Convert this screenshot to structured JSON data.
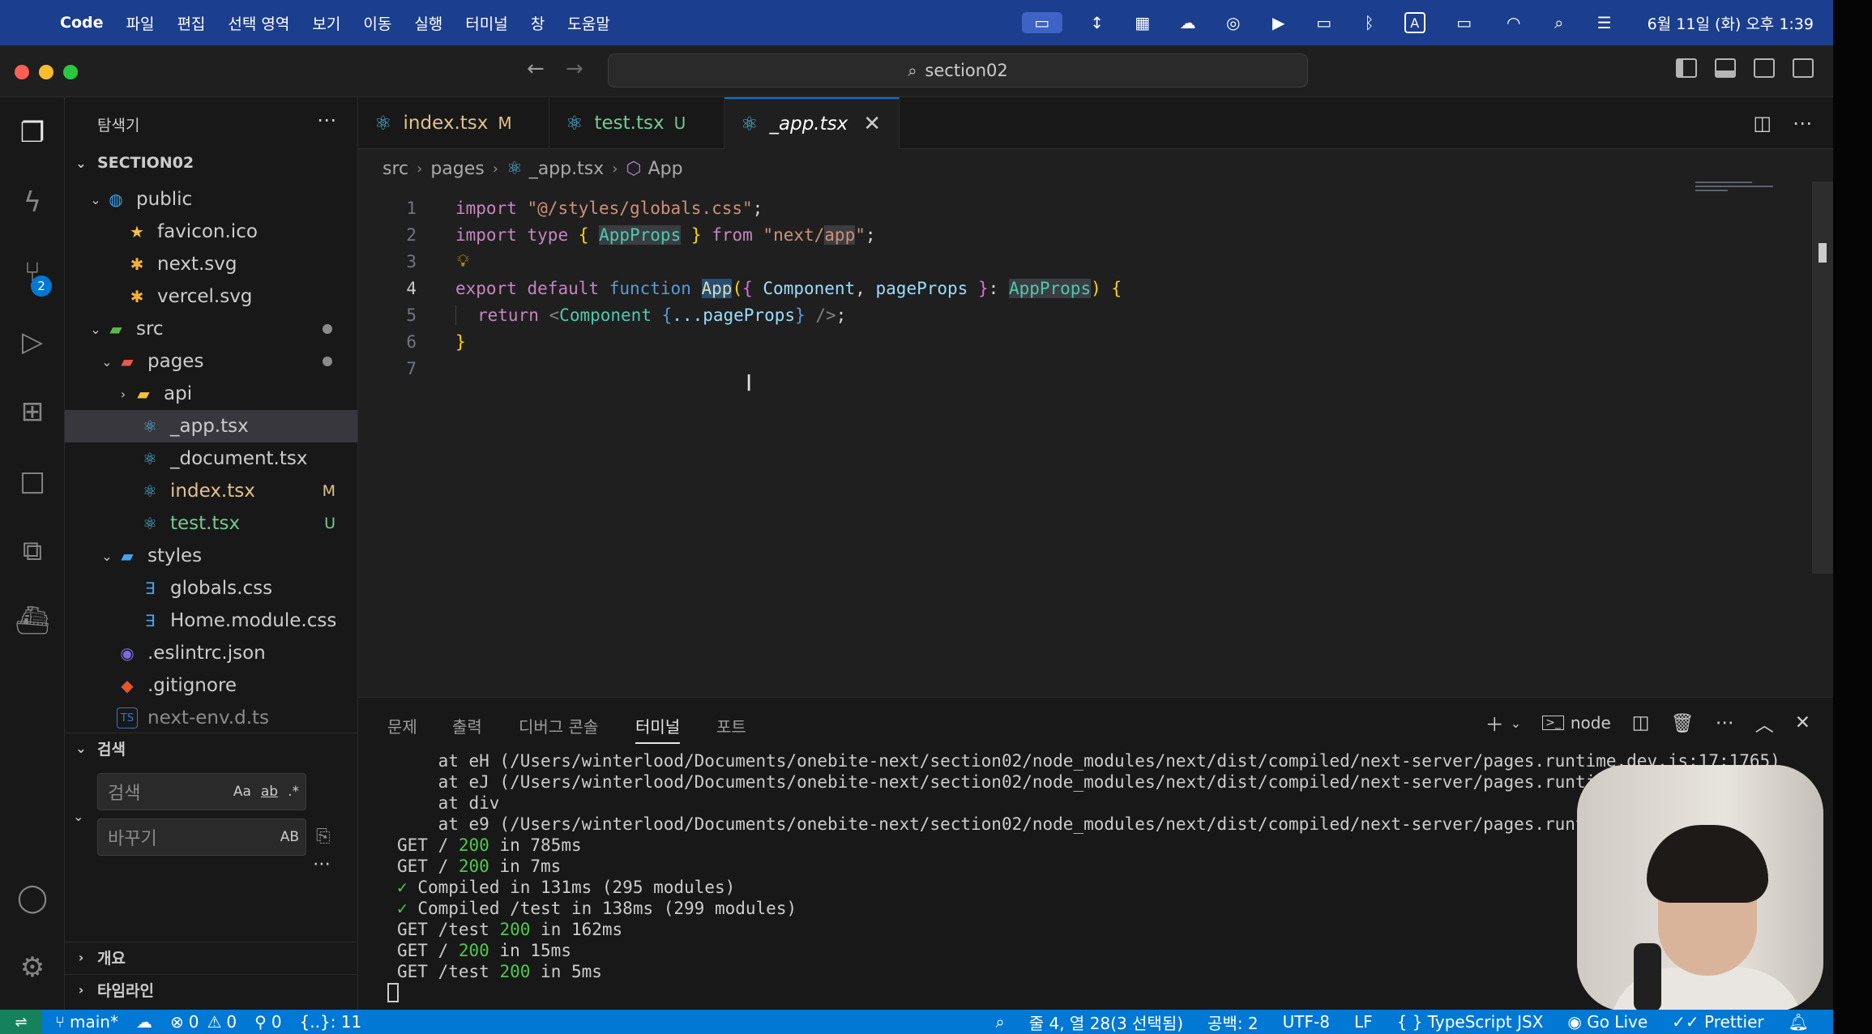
{
  "menubar": {
    "app": "Code",
    "items": [
      "파일",
      "편집",
      "선택 영역",
      "보기",
      "이동",
      "실행",
      "터미널",
      "창",
      "도움말"
    ],
    "clock": "6월 11일 (화) 오후 1:39",
    "input_mode": "A"
  },
  "titlebar": {
    "search_text": "section02"
  },
  "activity": {
    "scm_badge": "2"
  },
  "explorer": {
    "title": "탐색기",
    "root": "SECTION02",
    "tree": [
      {
        "label": "public",
        "badge": ""
      },
      {
        "label": "favicon.ico",
        "badge": ""
      },
      {
        "label": "next.svg",
        "badge": ""
      },
      {
        "label": "vercel.svg",
        "badge": ""
      },
      {
        "label": "src",
        "badge": ""
      },
      {
        "label": "pages",
        "badge": ""
      },
      {
        "label": "api",
        "badge": ""
      },
      {
        "label": "_app.tsx",
        "badge": ""
      },
      {
        "label": "_document.tsx",
        "badge": ""
      },
      {
        "label": "index.tsx",
        "badge": "M"
      },
      {
        "label": "test.tsx",
        "badge": "U"
      },
      {
        "label": "styles",
        "badge": ""
      },
      {
        "label": "globals.css",
        "badge": ""
      },
      {
        "label": "Home.module.css",
        "badge": ""
      },
      {
        "label": ".eslintrc.json",
        "badge": ""
      },
      {
        "label": ".gitignore",
        "badge": ""
      },
      {
        "label": "next-env.d.ts",
        "badge": ""
      }
    ],
    "search_section": "검색",
    "search_placeholder": "검색",
    "search_opts": [
      "Aa",
      "ab",
      ".*"
    ],
    "replace_placeholder": "바꾸기",
    "replace_opt": "AB",
    "outline": "개요",
    "timeline": "타임라인"
  },
  "tabs": [
    {
      "label": "index.tsx",
      "state": "M"
    },
    {
      "label": "test.tsx",
      "state": "U"
    },
    {
      "label": "_app.tsx",
      "state": ""
    }
  ],
  "breadcrumb": [
    "src",
    "pages",
    "_app.tsx",
    "App"
  ],
  "code": {
    "line_numbers": [
      "1",
      "2",
      "3",
      "4",
      "5",
      "6",
      "7"
    ],
    "l1": {
      "kw": "import",
      "str": "\"@/styles/globals.css\"",
      "end": ";"
    },
    "l2": {
      "kw": "import",
      "kw2": "type",
      "ob": "{",
      "name": "AppProps",
      "cb": "}",
      "from": "from",
      "str_a": "\"next/",
      "str_b": "app",
      "str_c": "\"",
      "end": ";"
    },
    "l4": {
      "export": "export",
      "default": "default",
      "function": "function",
      "fn": "App",
      "p1": "(",
      "b1": "{",
      "comp": "Component",
      "comma": ",",
      "pp": "pageProps",
      "b2": "}",
      "colon": ":",
      "typ": "AppProps",
      "p2": ")",
      "b3": "{"
    },
    "l5": {
      "ret": "return",
      "lt": "<",
      "tag": "Component",
      "ob": "{",
      "spread": "...pageProps",
      "cb": "}",
      "close": "/>",
      "end": ";"
    },
    "l6": {
      "cb": "}"
    }
  },
  "panel": {
    "tabs": [
      "문제",
      "출력",
      "디버그 콘솔",
      "터미널",
      "포트"
    ],
    "shell": "node",
    "lines": [
      "    at eH (/Users/winterlood/Documents/onebite-next/section02/node_modules/next/dist/compiled/next-server/pages.runtime.dev.js:17:1765)",
      "    at eJ (/Users/winterlood/Documents/onebite-next/section02/node_modules/next/dist/compiled/next-server/pages.runtime.dev.js:17:1765)",
      "    at div",
      "    at e9 (/Users/winterlood/Documents/onebite-next/section02/node_modules/next/dist/compiled/next-server/pages.runtime.dev.js:17:1765)"
    ],
    "log": [
      {
        "prefix": "",
        "method": "GET /",
        "status": "200",
        "rest": "in 785ms"
      },
      {
        "prefix": "",
        "method": "GET /",
        "status": "200",
        "rest": "in 7ms"
      },
      {
        "prefix": "✓",
        "method": "Compiled in 131ms (295 modules)",
        "status": "",
        "rest": ""
      },
      {
        "prefix": "✓",
        "method": "Compiled /test in 138ms (299 modules)",
        "status": "",
        "rest": ""
      },
      {
        "prefix": "",
        "method": "GET /test",
        "status": "200",
        "rest": "in 162ms"
      },
      {
        "prefix": "",
        "method": "GET /",
        "status": "200",
        "rest": "in 15ms"
      },
      {
        "prefix": "",
        "method": "GET /test",
        "status": "200",
        "rest": "in 5ms"
      }
    ]
  },
  "status": {
    "branch": "main*",
    "errors": "0",
    "warnings": "0",
    "ports": "0",
    "braces": "{..}: 11",
    "position": "줄 4, 열 28(3 선택됨)",
    "spaces": "공백: 2",
    "encoding": "UTF-8",
    "eol": "LF",
    "language": "TypeScript JSX",
    "golive": "Go Live",
    "prettier": "Prettier"
  }
}
